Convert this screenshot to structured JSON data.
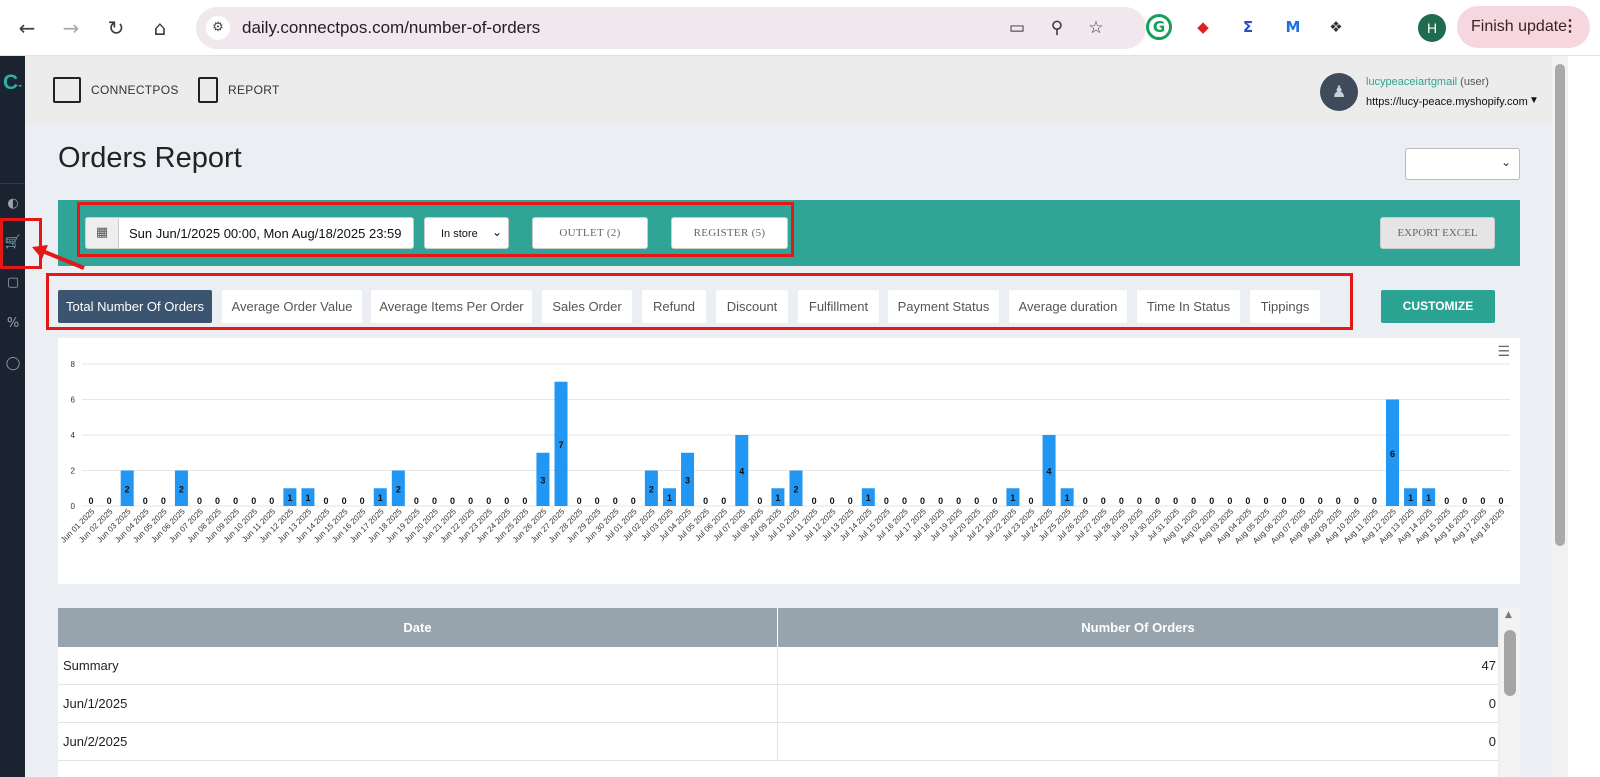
{
  "browser": {
    "url": "daily.connectpos.com/number-of-orders",
    "profile_initial": "H",
    "finish_update": "Finish update"
  },
  "sidebar": {
    "logo": "C"
  },
  "header": {
    "links": [
      "CONNECTPOS",
      "REPORT"
    ],
    "user_name": "lucypeaceiartgmail",
    "user_role": "(user)",
    "user_url": "https://lucy-peace.myshopify.com"
  },
  "page": {
    "title": "Orders Report"
  },
  "filters": {
    "date_range": "Sun Jun/1/2025 00:00, Mon Aug/18/2025 23:59",
    "store_type": "In store",
    "outlet": "OUTLET (2)",
    "register": "REGISTER (5)",
    "export": "EXPORT EXCEL"
  },
  "tabs": [
    "Total Number Of Orders",
    "Average Order Value",
    "Average Items Per Order",
    "Sales Order",
    "Refund",
    "Discount",
    "Fulfillment",
    "Payment Status",
    "Average duration",
    "Time In Status",
    "Tippings"
  ],
  "active_tab": "Total Number Of Orders",
  "customize_label": "CUSTOMIZE",
  "colors": {
    "teal": "#30a597",
    "bar": "#2196f3",
    "active_tab": "#3b5570",
    "highlight": "#e61717"
  },
  "chart_data": {
    "type": "bar",
    "ylim": [
      0,
      8
    ],
    "yticks": [
      0,
      2,
      4,
      6,
      8
    ],
    "grid": true,
    "categories": [
      "Jun 01 2025",
      "Jun 02 2025",
      "Jun 03 2025",
      "Jun 04 2025",
      "Jun 05 2025",
      "Jun 06 2025",
      "Jun 07 2025",
      "Jun 08 2025",
      "Jun 09 2025",
      "Jun 10 2025",
      "Jun 11 2025",
      "Jun 12 2025",
      "Jun 13 2025",
      "Jun 14 2025",
      "Jun 15 2025",
      "Jun 16 2025",
      "Jun 17 2025",
      "Jun 18 2025",
      "Jun 19 2025",
      "Jun 20 2025",
      "Jun 21 2025",
      "Jun 22 2025",
      "Jun 23 2025",
      "Jun 24 2025",
      "Jun 25 2025",
      "Jun 26 2025",
      "Jun 27 2025",
      "Jun 28 2025",
      "Jun 29 2025",
      "Jun 30 2025",
      "Jul 01 2025",
      "Jul 02 2025",
      "Jul 03 2025",
      "Jul 04 2025",
      "Jul 05 2025",
      "Jul 06 2025",
      "Jul 07 2025",
      "Jul 08 2025",
      "Jul 09 2025",
      "Jul 10 2025",
      "Jul 11 2025",
      "Jul 12 2025",
      "Jul 13 2025",
      "Jul 14 2025",
      "Jul 15 2025",
      "Jul 16 2025",
      "Jul 17 2025",
      "Jul 18 2025",
      "Jul 19 2025",
      "Jul 20 2025",
      "Jul 21 2025",
      "Jul 22 2025",
      "Jul 23 2025",
      "Jul 24 2025",
      "Jul 25 2025",
      "Jul 26 2025",
      "Jul 27 2025",
      "Jul 28 2025",
      "Jul 29 2025",
      "Jul 30 2025",
      "Jul 31 2025",
      "Aug 01 2025",
      "Aug 02 2025",
      "Aug 03 2025",
      "Aug 04 2025",
      "Aug 05 2025",
      "Aug 06 2025",
      "Aug 07 2025",
      "Aug 08 2025",
      "Aug 09 2025",
      "Aug 10 2025",
      "Aug 11 2025",
      "Aug 12 2025",
      "Aug 13 2025",
      "Aug 14 2025",
      "Aug 15 2025",
      "Aug 16 2025",
      "Aug 17 2025",
      "Aug 18 2025"
    ],
    "values": [
      0,
      0,
      2,
      0,
      0,
      2,
      0,
      0,
      0,
      0,
      0,
      1,
      1,
      0,
      0,
      0,
      1,
      2,
      0,
      0,
      0,
      0,
      0,
      0,
      0,
      3,
      7,
      0,
      0,
      0,
      0,
      2,
      1,
      3,
      0,
      0,
      4,
      0,
      1,
      2,
      0,
      0,
      0,
      1,
      0,
      0,
      0,
      0,
      0,
      0,
      0,
      1,
      0,
      4,
      1,
      0,
      0,
      0,
      0,
      0,
      0,
      0,
      0,
      0,
      0,
      0,
      0,
      0,
      0,
      0,
      0,
      0,
      6,
      1,
      1,
      0,
      0,
      0,
      0
    ]
  },
  "table": {
    "headers": [
      "Date",
      "Number Of Orders"
    ],
    "rows": [
      [
        "Summary",
        "47"
      ],
      [
        "Jun/1/2025",
        "0"
      ],
      [
        "Jun/2/2025",
        "0"
      ]
    ]
  }
}
